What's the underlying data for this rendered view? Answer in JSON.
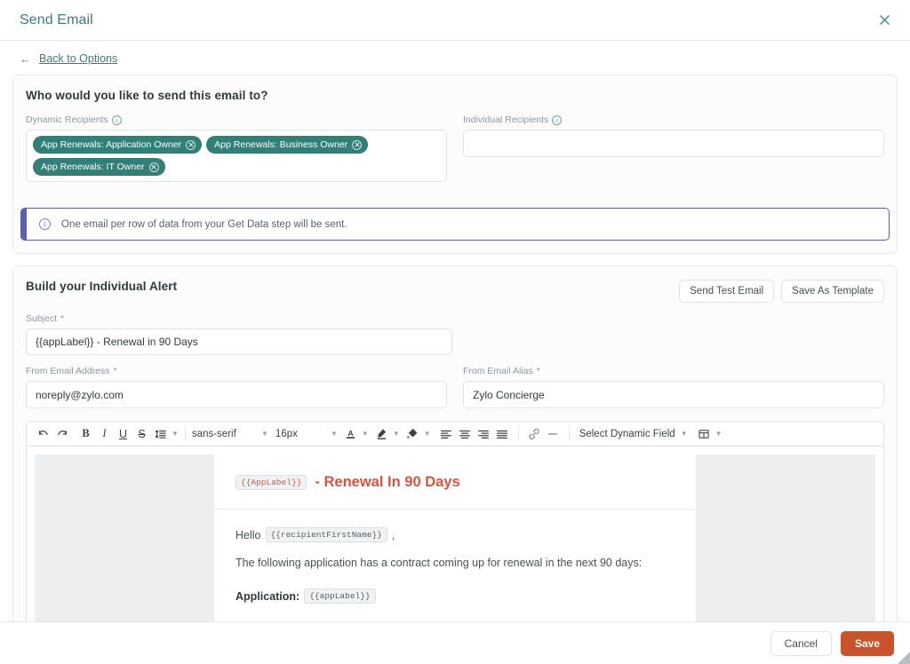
{
  "window": {
    "title": "Send Email",
    "close_icon": "close-icon"
  },
  "back": {
    "arrow": "←",
    "label": "Back to Options"
  },
  "recipients": {
    "title": "Who would you like to send this email to?",
    "dynamic_label": "Dynamic Recipients",
    "dynamic_chips": [
      "App Renewals: Application Owner",
      "App Renewals: Business Owner",
      "App Renewals: IT Owner"
    ],
    "individual_label": "Individual Recipients",
    "individual_value": "",
    "individual_placeholder": "",
    "banner_text": "One email per row of data from your Get Data step will be sent.",
    "chip_color": "#317f76",
    "banner_color": "#5b5fb5"
  },
  "build": {
    "title": "Build your Individual Alert",
    "send_test_label": "Send Test Email",
    "save_template_label": "Save As Template",
    "subject_label": "Subject",
    "subject_value": "{{appLabel}} - Renewal in 90 Days",
    "from_email_label": "From Email Address",
    "from_email_value": "noreply@zylo.com",
    "from_alias_label": "From Email Alias",
    "from_alias_value": "Zylo Concierge",
    "required_marker": "*"
  },
  "toolbar": {
    "undo": "undo-icon",
    "redo": "redo-icon",
    "bold": "B",
    "italic": "I",
    "underline": "U",
    "strikethrough": "S",
    "line_height": "line-height-icon",
    "font_family": "sans-serif",
    "font_size": "16px",
    "text_color": "A",
    "highlight": "highlight-icon",
    "fill": "fill-icon",
    "align_left": "align-left-icon",
    "align_center": "align-center-icon",
    "align_right": "align-right-icon",
    "align_justify": "align-justify-icon",
    "link": "link-icon",
    "horizontal_rule": "horizontal-rule-icon",
    "dynamic_field": "Select Dynamic Field",
    "table": "table-icon"
  },
  "email": {
    "title_chip": "{{AppLabel}}",
    "title_text": "- Renewal In 90 Days",
    "title_color": "#d9543a",
    "greeting_prefix": "Hello",
    "greeting_chip": "{{recipientFirstName}}",
    "greeting_suffix": ",",
    "paragraph": "The following application has a contract coming up for renewal in the next 90 days:",
    "application_label": "Application:",
    "application_chip": "{{appLabel}}"
  },
  "footer": {
    "cancel_label": "Cancel",
    "save_label": "Save",
    "save_color": "#c9532b"
  }
}
